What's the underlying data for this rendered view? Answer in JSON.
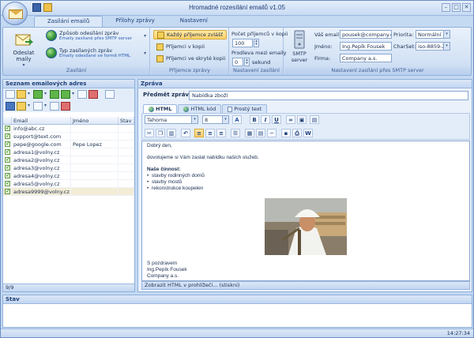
{
  "window": {
    "title": "Hromadné rozesílání emailů v1.05",
    "controls": [
      "–",
      "□",
      "✕"
    ]
  },
  "ribbon_tabs": [
    "Zasílání emailů",
    "Přílohy zprávy",
    "Nastavení"
  ],
  "ribbon": {
    "zasilani": {
      "caption": "Zasílání",
      "send_button": "Odeslat maily",
      "method_title": "Způsob odesílání zpráv",
      "method_sub": "Emaily zasílané přes SMTP server",
      "type_title": "Typ zasílaných zpráv",
      "type_sub": "Emaily odesílané ve formě HTML"
    },
    "recipients": {
      "caption": "Příjemce zprávy",
      "every": "Každý příjemce zvlášť",
      "copy": "Příjemci v kopii",
      "hidden": "Příjemci ve skryté kopii"
    },
    "settings": {
      "caption": "Nastavení zasílání",
      "count_label": "Počet příjemců v kopii",
      "count_value": "100",
      "delay_label": "Prodleva mezi emaily",
      "delay_value": "0",
      "delay_unit": "sekund"
    },
    "smtp": {
      "caption": "Nastavení zasílání přes SMTP server",
      "button": "SMTP server",
      "email_label": "Váš email:",
      "email_value": "pousek@company.co",
      "name_label": "Jméno:",
      "name_value": "Ing.Pepík Fousek",
      "company_label": "Firma:",
      "company_value": "Company a.s.",
      "priority_label": "Priorita:",
      "priority_value": "Normální",
      "charset_label": "CharSet:",
      "charset_value": "iso-8859-2"
    }
  },
  "address_list": {
    "title": "Seznam emailových adres",
    "columns": [
      "Email",
      "Jméno",
      "Stav"
    ],
    "rows": [
      {
        "email": "info@abc.cz",
        "name": "",
        "status": ""
      },
      {
        "email": "support@text.com",
        "name": "",
        "status": ""
      },
      {
        "email": "pepe@google.com",
        "name": "Pepe Lopez",
        "status": ""
      },
      {
        "email": "adresa1@volny.cz",
        "name": "",
        "status": ""
      },
      {
        "email": "adresa2@volny.cz",
        "name": "",
        "status": ""
      },
      {
        "email": "adresa3@volny.cz",
        "name": "",
        "status": ""
      },
      {
        "email": "adresa4@volny.cz",
        "name": "",
        "status": ""
      },
      {
        "email": "adresa5@volny.cz",
        "name": "",
        "status": ""
      },
      {
        "email": "adresa9999@volny.cz",
        "name": "",
        "status": ""
      }
    ],
    "counter": "9/9"
  },
  "message": {
    "panel_title": "Zpráva",
    "subject_label": "Předmět zprávy:",
    "subject_value": "Nabídka zboží",
    "editor_tabs": [
      "HTML",
      "HTML kód",
      "Prostý text"
    ],
    "font_name": "Tahoma",
    "font_size": "8",
    "body": {
      "greeting": "Dobrý den,",
      "intro": "dovolujeme si Vám zaslat nabídku našich služeb.",
      "heading": "Naše činnost:",
      "items": [
        "stavby rodinných domů",
        "stavby mostů",
        "rekonstrukce koupelen"
      ],
      "closing": "S pozdravem",
      "sig_name": "Ing.Pepík Fousek",
      "sig_company": "Company a.s."
    },
    "footer": "Zobrazit HTML v prohlížeči... (stiskni)"
  },
  "stav": {
    "title": "Stav"
  },
  "statusbar": {
    "time": "14:27:34"
  }
}
